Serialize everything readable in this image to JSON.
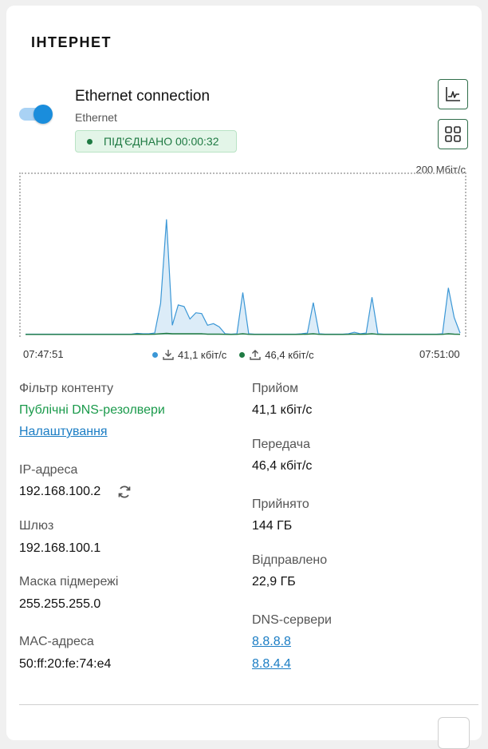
{
  "section": {
    "title": "ІНТЕРНЕТ"
  },
  "connection": {
    "name": "Ethernet connection",
    "type": "Ethernet",
    "enabled": true,
    "status": "ПІД'ЄДНАНО 00:00:32"
  },
  "chart": {
    "max_label": "200 Мбіт/с",
    "start_time": "07:47:51",
    "end_time": "07:51:00",
    "download_label": "41,1 кбіт/с",
    "upload_label": "46,4 кбіт/с",
    "download_color": "#3b97d6",
    "upload_color": "#1f7a43"
  },
  "chart_data": {
    "type": "area",
    "ylim": [
      0,
      200
    ],
    "series": [
      {
        "values": [
          0.5,
          0.5,
          0.5,
          0.5,
          0.5,
          0.5,
          0.5,
          0.5,
          0.5,
          0.5,
          0.5,
          0.5,
          0.5,
          0.5,
          0.5,
          0.5,
          0.5,
          0.5,
          0.5,
          1.5,
          1,
          1,
          2,
          40,
          148,
          12,
          38,
          36,
          20,
          28,
          27,
          12,
          14,
          10,
          1,
          0.5,
          1,
          54,
          1,
          0.5,
          0.5,
          0.5,
          0.5,
          0.5,
          0.5,
          0.5,
          0.5,
          1,
          2,
          41,
          1,
          0.5,
          0.5,
          0.5,
          0.5,
          1,
          3,
          1,
          2,
          48,
          1,
          0.5,
          0.5,
          0.5,
          0.5,
          0.5,
          0.5,
          0.5,
          0.5,
          0.5,
          0.5,
          1,
          60,
          22,
          2
        ]
      },
      {
        "values": [
          0.2,
          0.2,
          0.2,
          0.2,
          0.2,
          0.2,
          0.2,
          0.2,
          0.2,
          0.2,
          0.2,
          0.2,
          0.2,
          0.2,
          0.2,
          0.2,
          0.2,
          0.2,
          0.2,
          0.5,
          0.3,
          0.3,
          0.5,
          1,
          1.5,
          1,
          1,
          1,
          1,
          1,
          1,
          0.5,
          0.5,
          0.5,
          0.3,
          0.2,
          0.3,
          1,
          0.3,
          0.2,
          0.2,
          0.2,
          0.2,
          0.2,
          0.2,
          0.2,
          0.2,
          0.3,
          0.5,
          1,
          0.3,
          0.2,
          0.2,
          0.2,
          0.2,
          0.3,
          0.6,
          0.3,
          0.5,
          1,
          0.3,
          0.2,
          0.2,
          0.2,
          0.2,
          0.2,
          0.2,
          0.2,
          0.2,
          0.2,
          0.2,
          0.3,
          1,
          0.5,
          0.3
        ]
      }
    ]
  },
  "details": {
    "content_filter": {
      "label": "Фільтр контенту",
      "value": "Публічні DNS-резолвери",
      "settings_link": "Налаштування"
    },
    "ip": {
      "label": "IP-адреса",
      "value": "192.168.100.2"
    },
    "gateway": {
      "label": "Шлюз",
      "value": "192.168.100.1"
    },
    "subnet": {
      "label": "Маска підмережі",
      "value": "255.255.255.0"
    },
    "mac": {
      "label": "MAC-адреса",
      "value": "50:ff:20:fe:74:e4"
    },
    "rx_rate": {
      "label": "Прийом",
      "value": "41,1 кбіт/с"
    },
    "tx_rate": {
      "label": "Передача",
      "value": "46,4 кбіт/с"
    },
    "received": {
      "label": "Прийнято",
      "value": "144 ГБ"
    },
    "sent": {
      "label": "Відправлено",
      "value": "22,9 ГБ"
    },
    "dns": {
      "label": "DNS-сервери",
      "servers": [
        "8.8.8.8",
        "8.8.4.4"
      ]
    }
  },
  "icons": {
    "stats_button": "line-chart-icon",
    "layout_button": "grid-icon",
    "refresh": "refresh-icon",
    "download": "download-icon",
    "upload": "upload-icon"
  }
}
